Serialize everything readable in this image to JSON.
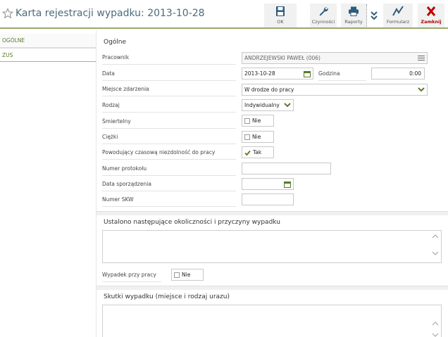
{
  "header": {
    "title": "Karta rejestracji wypadku: 2013-10-28",
    "toolbar": {
      "ok": "OK",
      "czynnosci": "Czynności",
      "raporty": "Raporty",
      "formularz": "Formularz",
      "zamknij": "Zamknij"
    }
  },
  "sidebar": {
    "items": [
      "OGÓLNE",
      "ZUS"
    ]
  },
  "form": {
    "section_title": "Ogólne",
    "pracownik": {
      "label": "Pracownik",
      "value": "ANDRZEJEWSKI PAWEŁ (006)"
    },
    "data": {
      "label": "Data",
      "value": "2013-10-28"
    },
    "godzina": {
      "label": "Godzina",
      "value": "0:00"
    },
    "miejsce": {
      "label": "Miejsce zdarzenia",
      "value": "W drodze do pracy"
    },
    "rodzaj": {
      "label": "Rodzaj",
      "value": "Indywidualny"
    },
    "smiertelny": {
      "label": "Śmiertelny",
      "value": "Nie"
    },
    "ciezki": {
      "label": "Ciężki",
      "value": "Nie"
    },
    "niezdolnosc": {
      "label": "Powodujący czasową niezdolność do pracy",
      "value": "Tak"
    },
    "numer_protokolu": {
      "label": "Numer protokołu",
      "value": ""
    },
    "data_sporzadzenia": {
      "label": "Data sporządzenia",
      "value": ""
    },
    "numer_skw": {
      "label": "Numer SKW",
      "value": ""
    }
  },
  "okolicznosci": {
    "title": "Ustalono następujące okoliczności i przyczyny wypadku",
    "value": "",
    "wypadek_przy_pracy": {
      "label": "Wypadek przy pracy",
      "value": "Nie"
    }
  },
  "skutki": {
    "title": "Skutki wypadku (miejsce i rodzaj urazu)",
    "value": ""
  },
  "colors": {
    "accent_green": "#5a7a2a",
    "title_blue": "#4a6c7c",
    "close_red": "#c00000"
  }
}
